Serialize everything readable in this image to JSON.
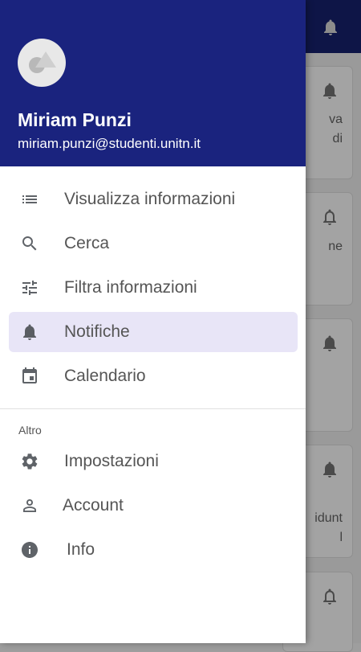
{
  "drawer": {
    "user_name": "Miriam Punzi",
    "user_email": "miriam.punzi@studenti.unitn.it",
    "main_items": [
      {
        "label": "Visualizza informazioni",
        "icon": "list-icon"
      },
      {
        "label": "Cerca",
        "icon": "search-icon"
      },
      {
        "label": "Filtra informazioni",
        "icon": "tune-icon"
      },
      {
        "label": "Notifiche",
        "icon": "bell-icon",
        "selected": true
      },
      {
        "label": "Calendario",
        "icon": "calendar-icon"
      }
    ],
    "section_label": "Altro",
    "other_items": [
      {
        "label": "Impostazioni",
        "icon": "gear-icon"
      },
      {
        "label": "Account",
        "icon": "person-icon"
      },
      {
        "label": "Info",
        "icon": "info-icon"
      }
    ]
  },
  "background": {
    "cards": [
      {
        "text_lines": [
          "va",
          "di"
        ]
      },
      {
        "text_lines": [
          "ne"
        ]
      },
      {
        "text_lines": []
      },
      {
        "text_lines": [
          "idunt",
          "l"
        ]
      },
      {
        "text_lines": []
      }
    ]
  },
  "colors": {
    "header": "#1a237e",
    "selected_item": "#e8e5f7"
  }
}
